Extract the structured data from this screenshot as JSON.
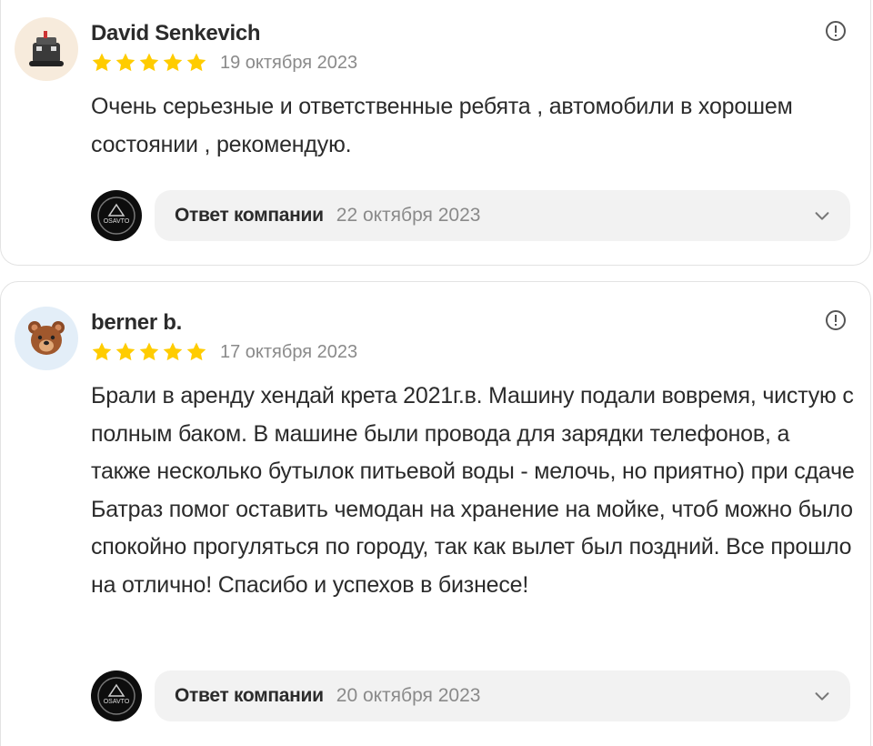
{
  "reviews": [
    {
      "author": "David Senkevich",
      "rating": 5,
      "date": "19 октября 2023",
      "text": "Очень серьезные и ответственные ребята , автомобили в хорошем состоянии , рекомендую.",
      "avatar_icon": "robot-avatar-icon",
      "reply": {
        "label": "Ответ компании",
        "date": "22 октября 2023",
        "logo_text": "OSAVTO"
      }
    },
    {
      "author": "berner b.",
      "rating": 5,
      "date": "17 октября 2023",
      "text": "Брали в аренду хендай крета 2021г.в. Машину подали вовремя, чистую с полным баком. В машине были провода для зарядки телефонов, а также несколько бутылок питьевой воды - мелочь, но приятно) при сдаче Батраз помог оставить чемодан на хранение на мойке, чтоб можно было спокойно прогуляться по городу, так как вылет был поздний. Все прошло на отлично! Спасибо и успехов в бизнесе!",
      "avatar_icon": "bear-avatar-icon",
      "reply": {
        "label": "Ответ компании",
        "date": "20 октября 2023",
        "logo_text": "OSAVTO"
      }
    }
  ],
  "colors": {
    "star": "#fc0",
    "muted_text": "#8a8a8a",
    "reply_bg": "#f2f2f2"
  }
}
